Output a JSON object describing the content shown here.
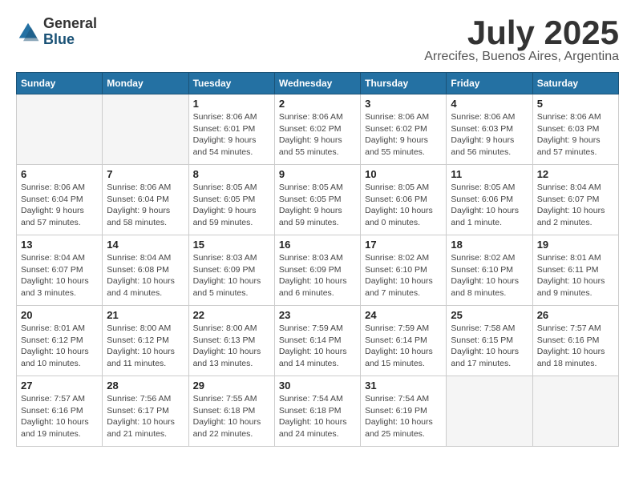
{
  "header": {
    "logo_general": "General",
    "logo_blue": "Blue",
    "title": "July 2025",
    "location": "Arrecifes, Buenos Aires, Argentina"
  },
  "weekdays": [
    "Sunday",
    "Monday",
    "Tuesday",
    "Wednesday",
    "Thursday",
    "Friday",
    "Saturday"
  ],
  "weeks": [
    [
      {
        "day": "",
        "info": ""
      },
      {
        "day": "",
        "info": ""
      },
      {
        "day": "1",
        "info": "Sunrise: 8:06 AM\nSunset: 6:01 PM\nDaylight: 9 hours and 54 minutes."
      },
      {
        "day": "2",
        "info": "Sunrise: 8:06 AM\nSunset: 6:02 PM\nDaylight: 9 hours and 55 minutes."
      },
      {
        "day": "3",
        "info": "Sunrise: 8:06 AM\nSunset: 6:02 PM\nDaylight: 9 hours and 55 minutes."
      },
      {
        "day": "4",
        "info": "Sunrise: 8:06 AM\nSunset: 6:03 PM\nDaylight: 9 hours and 56 minutes."
      },
      {
        "day": "5",
        "info": "Sunrise: 8:06 AM\nSunset: 6:03 PM\nDaylight: 9 hours and 57 minutes."
      }
    ],
    [
      {
        "day": "6",
        "info": "Sunrise: 8:06 AM\nSunset: 6:04 PM\nDaylight: 9 hours and 57 minutes."
      },
      {
        "day": "7",
        "info": "Sunrise: 8:06 AM\nSunset: 6:04 PM\nDaylight: 9 hours and 58 minutes."
      },
      {
        "day": "8",
        "info": "Sunrise: 8:05 AM\nSunset: 6:05 PM\nDaylight: 9 hours and 59 minutes."
      },
      {
        "day": "9",
        "info": "Sunrise: 8:05 AM\nSunset: 6:05 PM\nDaylight: 9 hours and 59 minutes."
      },
      {
        "day": "10",
        "info": "Sunrise: 8:05 AM\nSunset: 6:06 PM\nDaylight: 10 hours and 0 minutes."
      },
      {
        "day": "11",
        "info": "Sunrise: 8:05 AM\nSunset: 6:06 PM\nDaylight: 10 hours and 1 minute."
      },
      {
        "day": "12",
        "info": "Sunrise: 8:04 AM\nSunset: 6:07 PM\nDaylight: 10 hours and 2 minutes."
      }
    ],
    [
      {
        "day": "13",
        "info": "Sunrise: 8:04 AM\nSunset: 6:07 PM\nDaylight: 10 hours and 3 minutes."
      },
      {
        "day": "14",
        "info": "Sunrise: 8:04 AM\nSunset: 6:08 PM\nDaylight: 10 hours and 4 minutes."
      },
      {
        "day": "15",
        "info": "Sunrise: 8:03 AM\nSunset: 6:09 PM\nDaylight: 10 hours and 5 minutes."
      },
      {
        "day": "16",
        "info": "Sunrise: 8:03 AM\nSunset: 6:09 PM\nDaylight: 10 hours and 6 minutes."
      },
      {
        "day": "17",
        "info": "Sunrise: 8:02 AM\nSunset: 6:10 PM\nDaylight: 10 hours and 7 minutes."
      },
      {
        "day": "18",
        "info": "Sunrise: 8:02 AM\nSunset: 6:10 PM\nDaylight: 10 hours and 8 minutes."
      },
      {
        "day": "19",
        "info": "Sunrise: 8:01 AM\nSunset: 6:11 PM\nDaylight: 10 hours and 9 minutes."
      }
    ],
    [
      {
        "day": "20",
        "info": "Sunrise: 8:01 AM\nSunset: 6:12 PM\nDaylight: 10 hours and 10 minutes."
      },
      {
        "day": "21",
        "info": "Sunrise: 8:00 AM\nSunset: 6:12 PM\nDaylight: 10 hours and 11 minutes."
      },
      {
        "day": "22",
        "info": "Sunrise: 8:00 AM\nSunset: 6:13 PM\nDaylight: 10 hours and 13 minutes."
      },
      {
        "day": "23",
        "info": "Sunrise: 7:59 AM\nSunset: 6:14 PM\nDaylight: 10 hours and 14 minutes."
      },
      {
        "day": "24",
        "info": "Sunrise: 7:59 AM\nSunset: 6:14 PM\nDaylight: 10 hours and 15 minutes."
      },
      {
        "day": "25",
        "info": "Sunrise: 7:58 AM\nSunset: 6:15 PM\nDaylight: 10 hours and 17 minutes."
      },
      {
        "day": "26",
        "info": "Sunrise: 7:57 AM\nSunset: 6:16 PM\nDaylight: 10 hours and 18 minutes."
      }
    ],
    [
      {
        "day": "27",
        "info": "Sunrise: 7:57 AM\nSunset: 6:16 PM\nDaylight: 10 hours and 19 minutes."
      },
      {
        "day": "28",
        "info": "Sunrise: 7:56 AM\nSunset: 6:17 PM\nDaylight: 10 hours and 21 minutes."
      },
      {
        "day": "29",
        "info": "Sunrise: 7:55 AM\nSunset: 6:18 PM\nDaylight: 10 hours and 22 minutes."
      },
      {
        "day": "30",
        "info": "Sunrise: 7:54 AM\nSunset: 6:18 PM\nDaylight: 10 hours and 24 minutes."
      },
      {
        "day": "31",
        "info": "Sunrise: 7:54 AM\nSunset: 6:19 PM\nDaylight: 10 hours and 25 minutes."
      },
      {
        "day": "",
        "info": ""
      },
      {
        "day": "",
        "info": ""
      }
    ]
  ]
}
